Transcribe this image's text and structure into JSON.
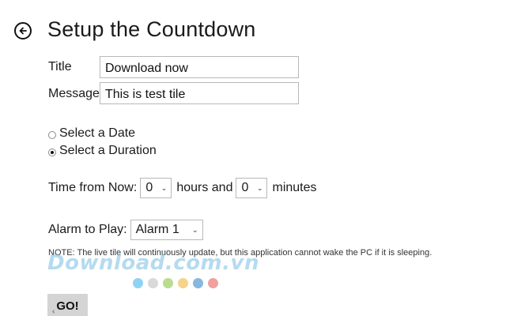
{
  "header": {
    "title": "Setup the Countdown"
  },
  "form": {
    "title_label": "Title",
    "title_value": "Download now",
    "message_label": "Message",
    "message_value": "This is test tile"
  },
  "mode_options": [
    {
      "label": "Select a Date",
      "selected": false
    },
    {
      "label": "Select a Duration",
      "selected": true
    }
  ],
  "duration": {
    "prefix": "Time from Now:",
    "hours_value": "0",
    "hours_suffix": "hours and",
    "minutes_value": "0",
    "minutes_suffix": "minutes"
  },
  "alarm": {
    "label": "Alarm to Play:",
    "value": "Alarm 1"
  },
  "note": "NOTE: The live tile will continuously update, but this application cannot wake the PC if it is sleeping.",
  "watermark": {
    "text": "Download.com.vn",
    "dot_colors": [
      "#8fd3f4",
      "#d9d9d9",
      "#b9dc8f",
      "#f6d28a",
      "#86b8e0",
      "#f0a0a0"
    ]
  },
  "actions": {
    "go_label": "GO!"
  },
  "icons": {
    "back": "back-arrow-icon",
    "dropdown": "chevron-down-icon",
    "scroll": "chevron-left-icon"
  }
}
